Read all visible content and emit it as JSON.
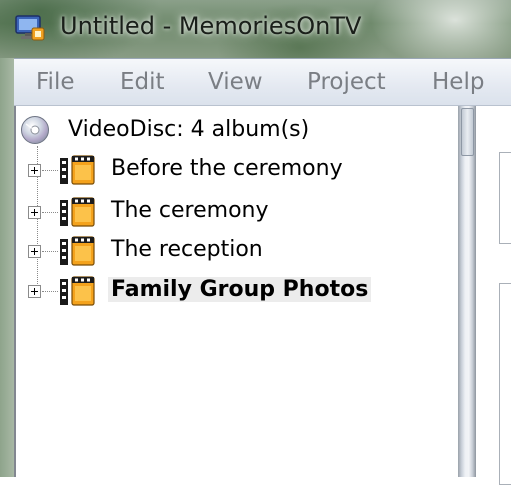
{
  "window": {
    "title": "Untitled - MemoriesOnTV",
    "icon": "monitor-app-icon"
  },
  "menu": {
    "items": [
      {
        "label": "File"
      },
      {
        "label": "Edit"
      },
      {
        "label": "View"
      },
      {
        "label": "Project"
      },
      {
        "label": "Help"
      }
    ]
  },
  "tree": {
    "root": {
      "label": "VideoDisc: 4 album(s)",
      "icon": "disc-icon"
    },
    "albums": [
      {
        "label": "Before the ceremony",
        "selected": false,
        "icon": "film-album-icon"
      },
      {
        "label": "The ceremony",
        "selected": false,
        "icon": "film-album-icon"
      },
      {
        "label": "The reception",
        "selected": false,
        "icon": "film-album-icon"
      },
      {
        "label": "Family Group Photos",
        "selected": true,
        "icon": "film-album-icon"
      }
    ]
  },
  "colors": {
    "selection_bg": "#ececec",
    "menu_text": "#7a7e84",
    "film_orange": "#f4a21c"
  }
}
